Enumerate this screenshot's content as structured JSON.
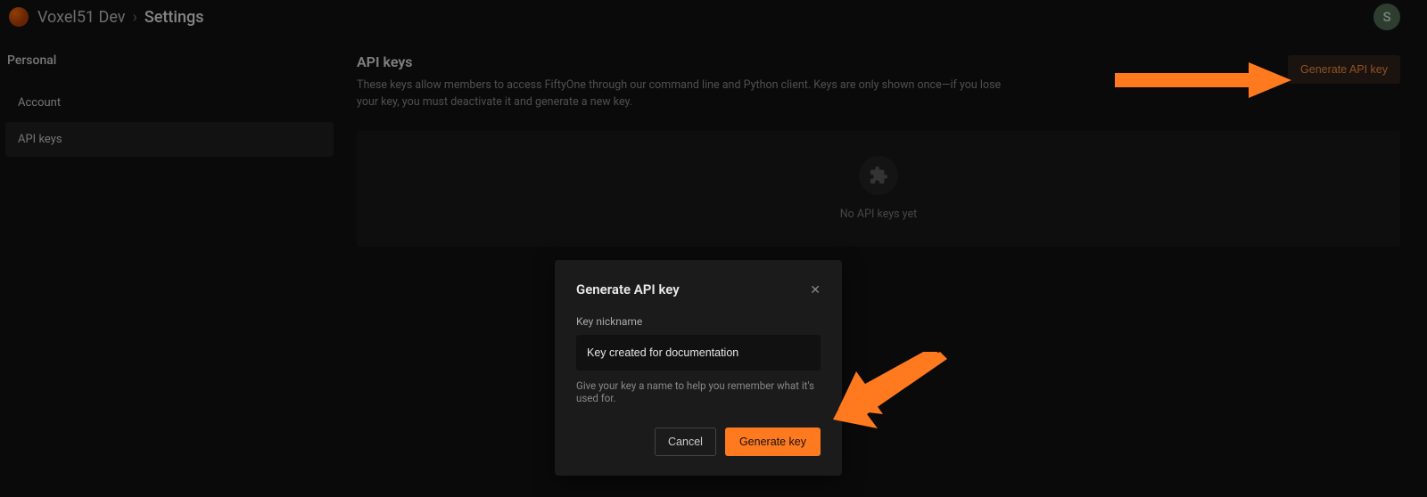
{
  "header": {
    "org": "Voxel51 Dev",
    "page": "Settings",
    "avatar_initial": "S"
  },
  "sidebar": {
    "heading": "Personal",
    "items": [
      {
        "label": "Account",
        "active": false
      },
      {
        "label": "API keys",
        "active": true
      }
    ]
  },
  "main": {
    "title": "API keys",
    "subtitle": "These keys allow members to access FiftyOne through our command line and Python client. Keys are only shown once—if you lose your key, you must deactivate it and generate a new key.",
    "generate_button": "Generate API key",
    "empty_text": "No API keys yet"
  },
  "modal": {
    "title": "Generate API key",
    "field_label": "Key nickname",
    "field_value": "Key created for documentation",
    "hint": "Give your key a name to help you remember what it's used for.",
    "cancel": "Cancel",
    "submit": "Generate key"
  },
  "colors": {
    "accent": "#ff7a1f"
  }
}
